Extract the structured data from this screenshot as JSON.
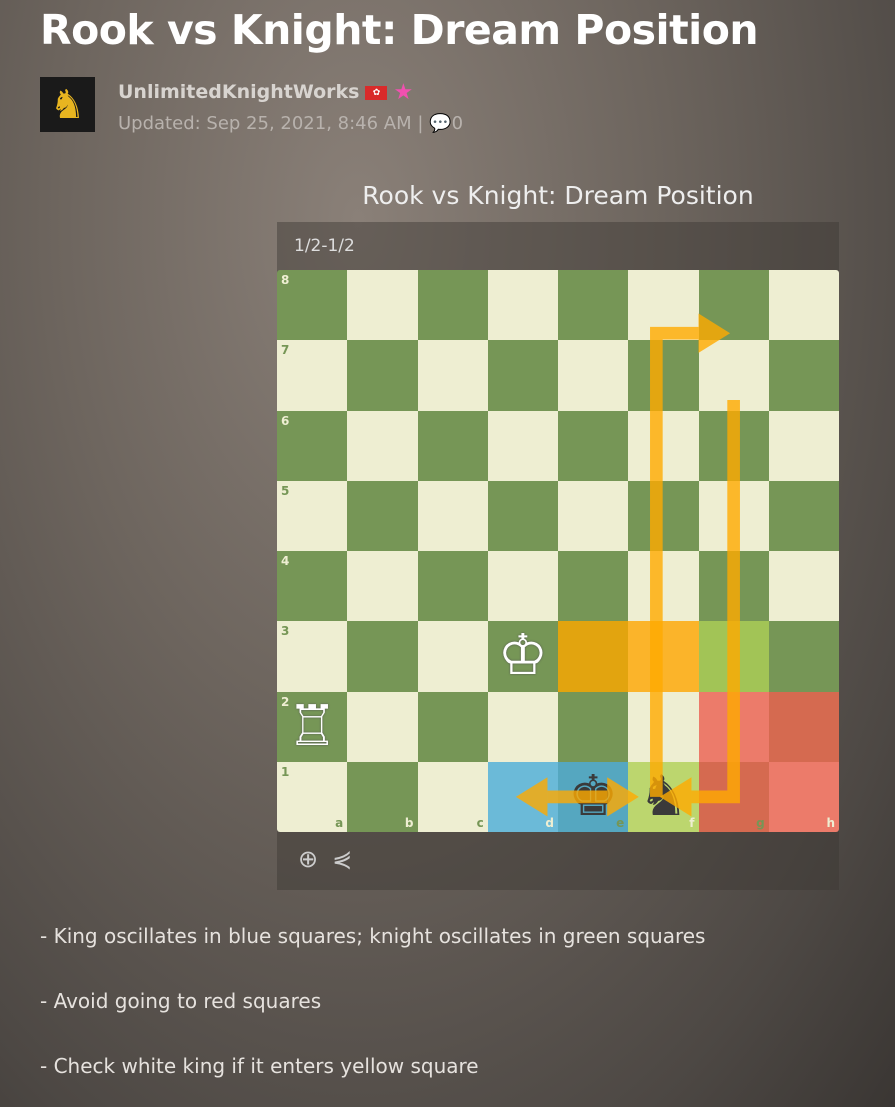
{
  "article": {
    "title": "Rook vs Knight: Dream Position",
    "author": "UnlimitedKnightWorks",
    "flag": "Hong Kong",
    "updated": "Updated: Sep 25, 2021, 8:46 AM |",
    "comments": "0"
  },
  "diagram": {
    "title": "Rook vs Knight: Dream Position",
    "result": "1/2-1/2",
    "files": [
      "a",
      "b",
      "c",
      "d",
      "e",
      "f",
      "g",
      "h"
    ],
    "pieces": {
      "d3": "♔",
      "a2": "♖",
      "e1": "♚",
      "f1": "♞"
    },
    "highlights": {
      "e3": "#e2a40f",
      "f3": "#fbb42a",
      "g3": "#a2c456",
      "d1": "#6bbad8",
      "e1": "#55a7c0",
      "f1": "#bcd66e",
      "g2": "#ec7b6a",
      "h2": "#d56a50",
      "g1": "#d56a50",
      "h1": "#ec7b6a"
    },
    "colors": {
      "light": "#eeeed2",
      "dark": "#769656",
      "arrow": "#ffaa00"
    },
    "tools": {
      "zoom": "zoom-icon",
      "share": "share-icon"
    }
  },
  "notes": [
    "- King oscillates in blue squares; knight oscillates in green squares",
    "- Avoid going to red squares",
    "- Check white king if it enters yellow square"
  ]
}
